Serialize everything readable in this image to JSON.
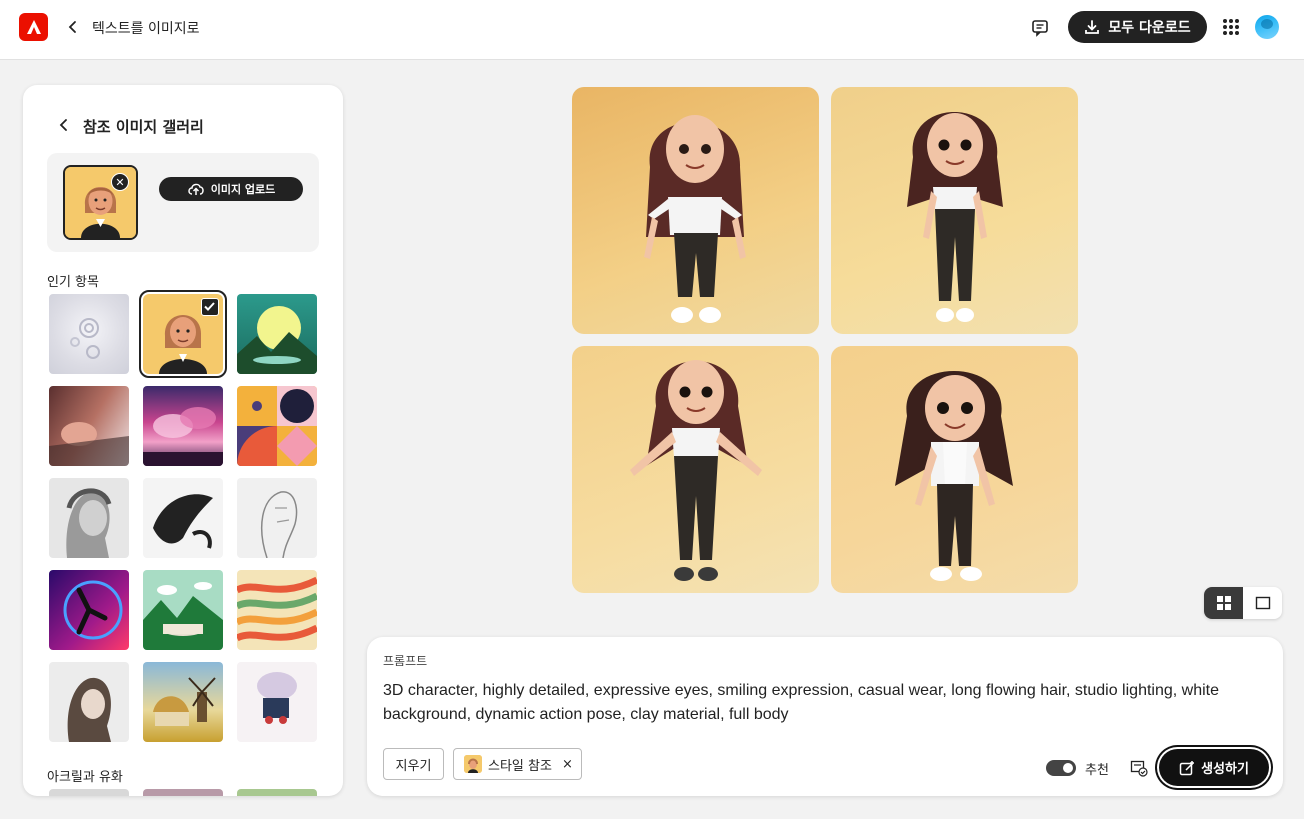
{
  "app": {
    "title": "텍스트를 이미지로",
    "download_all_label": "모두 다운로드",
    "brand_color": "#eb1000"
  },
  "gallery": {
    "title": "참조 이미지 갤러리",
    "upload_label": "이미지 업로드",
    "popular_label": "인기 항목",
    "next_section_label": "아크릴과 유화"
  },
  "view_toggle": {
    "selected": "grid"
  },
  "prompt": {
    "label": "프롬프트",
    "text": "3D character, highly detailed, expressive eyes, smiling expression, casual wear, long flowing hair, studio lighting, white background, dynamic action pose, clay material, full body",
    "clear_label": "지우기",
    "style_chip_label": "스타일 참조",
    "chip_close": "×",
    "recommend_label": "추천",
    "recommend_on": true,
    "generate_label": "생성하기"
  }
}
